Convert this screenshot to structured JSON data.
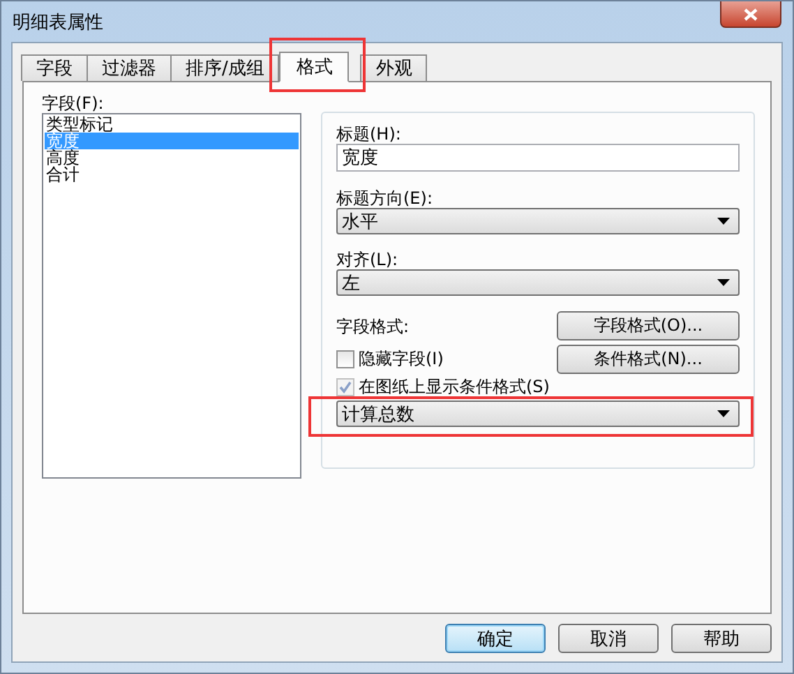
{
  "window": {
    "title": "明细表属性"
  },
  "tabs": [
    {
      "label": "字段",
      "selected": false,
      "highlighted": false
    },
    {
      "label": "过滤器",
      "selected": false,
      "highlighted": false
    },
    {
      "label": "排序/成组",
      "selected": false,
      "highlighted": false
    },
    {
      "label": "格式",
      "selected": true,
      "highlighted": true
    },
    {
      "label": "外观",
      "selected": false,
      "highlighted": false
    }
  ],
  "fields": {
    "label": "字段(F):",
    "items": [
      {
        "label": "类型标记",
        "selected": false
      },
      {
        "label": "宽度",
        "selected": true
      },
      {
        "label": "高度",
        "selected": false
      },
      {
        "label": "合计",
        "selected": false
      }
    ]
  },
  "format": {
    "heading": {
      "label": "标题(H):",
      "value": "宽度"
    },
    "heading_orientation": {
      "label": "标题方向(E):",
      "value": "水平"
    },
    "alignment": {
      "label": "对齐(L):",
      "value": "左"
    },
    "field_format": {
      "label": "字段格式:",
      "button": "字段格式(O)..."
    },
    "hidden_field": {
      "label": "隐藏字段(I)",
      "checked": false,
      "disabled": false
    },
    "conditional_format_button": "条件格式(N)...",
    "show_conditional_on_sheets": {
      "label": "在图纸上显示条件格式(S)",
      "checked": true,
      "disabled": true
    },
    "totals": {
      "value": "计算总数",
      "highlighted": true
    }
  },
  "buttons": [
    {
      "label": "确定",
      "default": true
    },
    {
      "label": "取消",
      "default": false
    },
    {
      "label": "帮助",
      "default": false
    }
  ]
}
